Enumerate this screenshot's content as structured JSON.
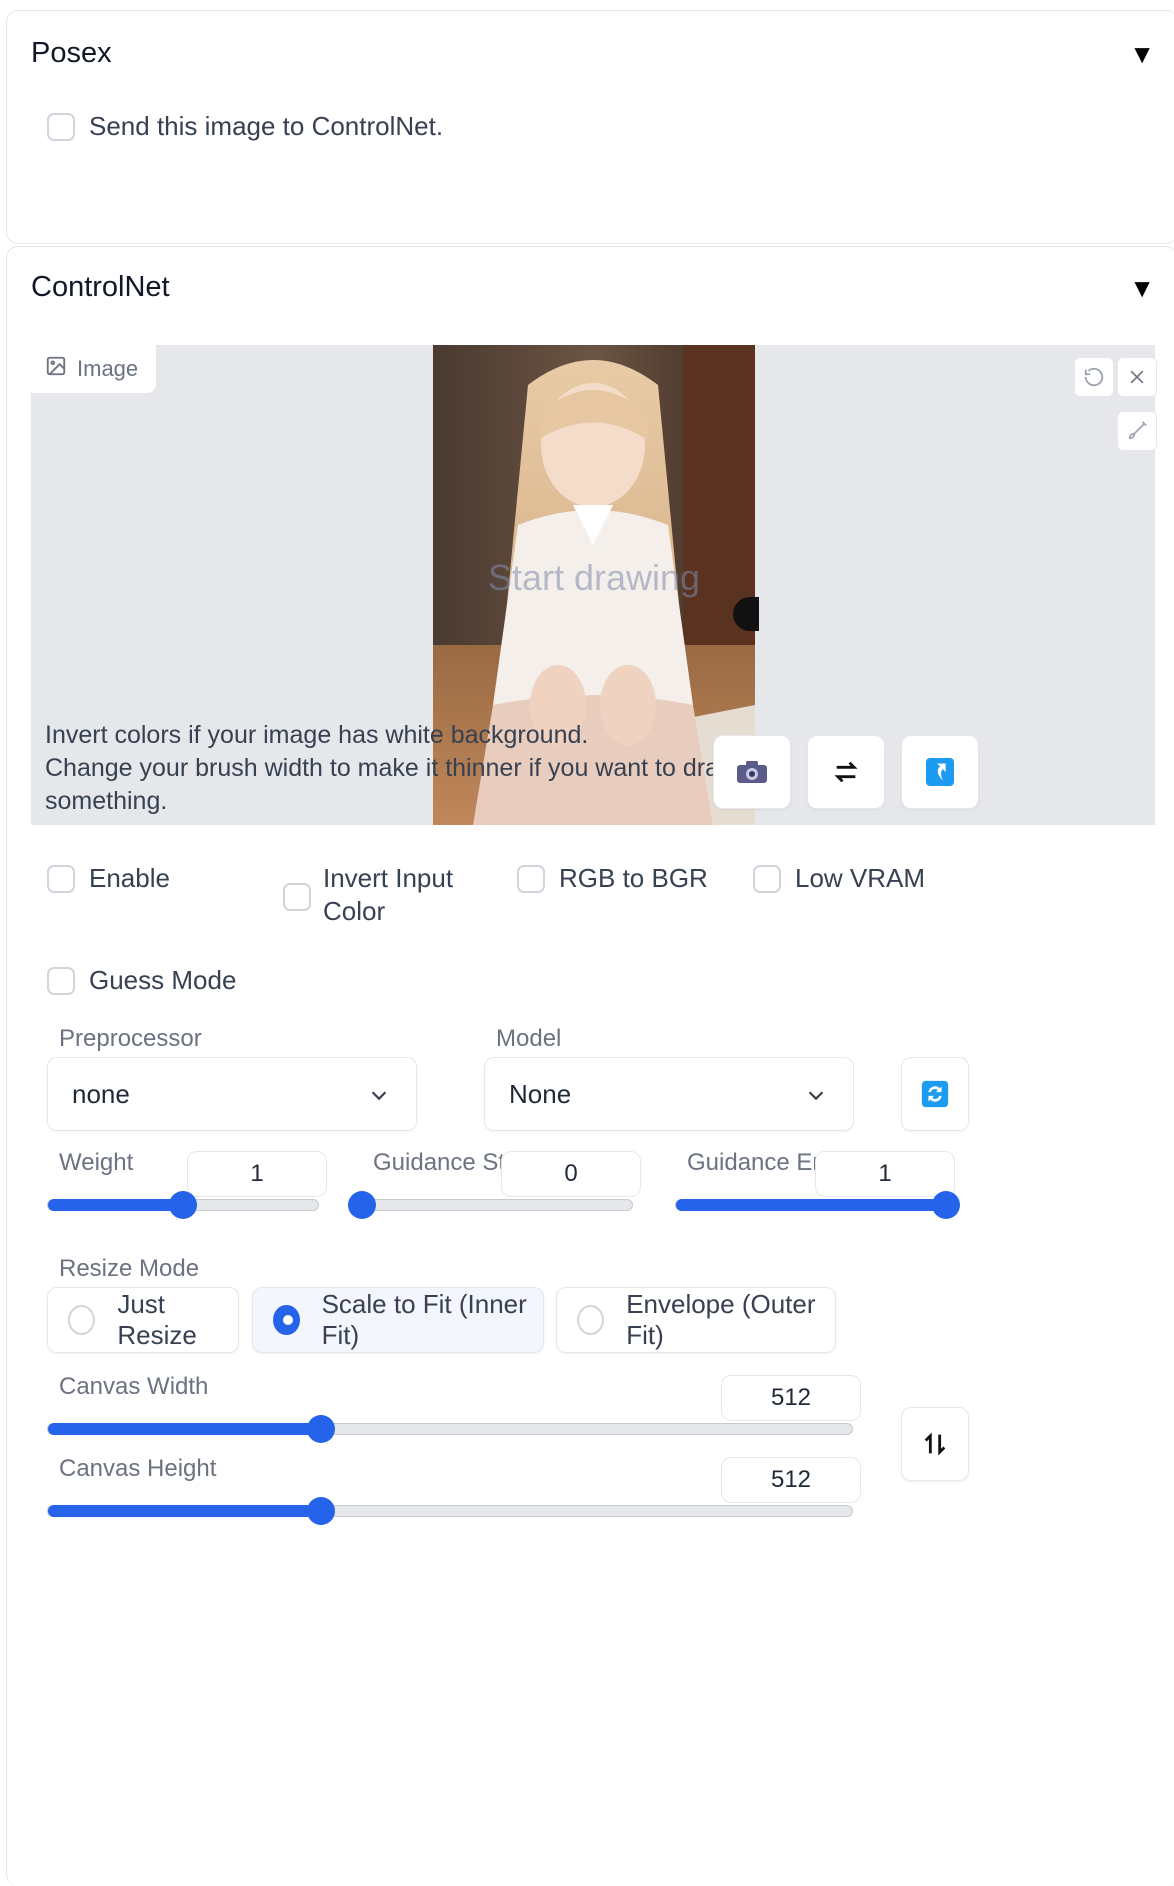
{
  "posex": {
    "title": "Posex",
    "send_label": "Send this image to ControlNet."
  },
  "controlnet": {
    "title": "ControlNet",
    "image_tab": "Image",
    "canvas_overlay": "Start drawing",
    "help_line1": "Invert colors if your image has white background.",
    "help_line2": "Change your brush width to make it thinner if you want to draw",
    "help_line3": "something.",
    "checkboxes": {
      "enable": "Enable",
      "invert_1": "Invert Input",
      "invert_2": "Color",
      "rgb_bgr": "RGB to BGR",
      "low_vram": "Low VRAM",
      "guess": "Guess Mode"
    },
    "preprocessor_label": "Preprocessor",
    "preprocessor_value": "none",
    "model_label": "Model",
    "model_value": "None",
    "weight": {
      "label": "Weight",
      "value": "1",
      "fraction": 0.5
    },
    "guidance_start": {
      "label": "Guidance Start",
      "value": "0",
      "fraction": 0
    },
    "guidance_end": {
      "label": "Guidance End",
      "value": "1",
      "fraction": 1
    },
    "resize_mode_label": "Resize Mode",
    "resize_options": [
      "Just Resize",
      "Scale to Fit (Inner Fit)",
      "Envelope (Outer Fit)"
    ],
    "resize_selected": 1,
    "canvas_width": {
      "label": "Canvas Width",
      "value": "512",
      "fraction": 0.34
    },
    "canvas_height": {
      "label": "Canvas Height",
      "value": "512",
      "fraction": 0.34
    }
  },
  "colors": {
    "accent": "#2563eb",
    "accent_light": "#1d9bf0"
  },
  "icons": {
    "image": "image-icon",
    "undo": "undo-icon",
    "close": "close-icon",
    "brush": "brush-icon",
    "camera": "camera-icon",
    "swap": "swap-arrows-icon",
    "send": "send-dimensions-icon",
    "refresh": "refresh-icon",
    "swap_vertical": "swap-vertical-icon",
    "chevron": "chevron-down-icon"
  }
}
